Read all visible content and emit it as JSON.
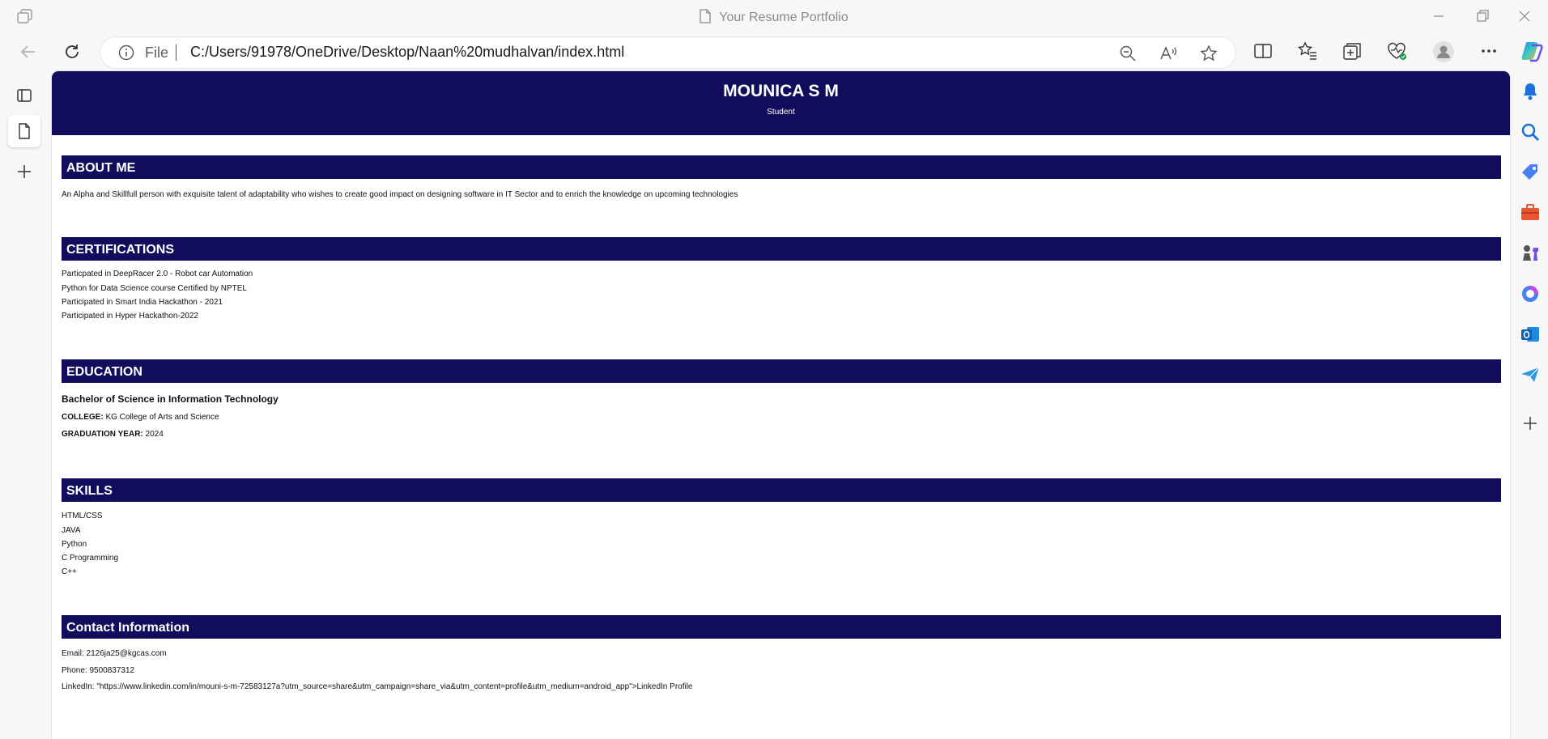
{
  "browser": {
    "tab_title": "Your Resume Portfolio",
    "address": {
      "scheme_label": "File",
      "url": "C:/Users/91978/OneDrive/Desktop/Naan%20mudhalvan/index.html"
    }
  },
  "resume": {
    "name": "MOUNICA S M",
    "role": "Student",
    "about": {
      "heading": "ABOUT ME",
      "text": "An Alpha and Skillfull person with exquisite talent of adaptability who wishes to create good impact on designing software in IT Sector and to enrich the knowledge on upcoming technologies"
    },
    "certifications": {
      "heading": "CERTIFICATIONS",
      "items": [
        "Particpated in DeepRacer 2.0 - Robot car Automation",
        "Python for Data Science course Certified by NPTEL",
        "Participated in Smart India Hackathon - 2021",
        "Participated in Hyper Hackathon-2022"
      ]
    },
    "education": {
      "heading": "EDUCATION",
      "degree": "Bachelor of Science in Information Technology",
      "college_label": "COLLEGE:",
      "college": "KG College of Arts and Science",
      "year_label": "GRADUATION YEAR:",
      "year": "2024"
    },
    "skills": {
      "heading": "SKILLS",
      "items": [
        "HTML/CSS",
        "JAVA",
        "Python",
        "C Programming",
        "C++"
      ]
    },
    "contact": {
      "heading": "Contact Information",
      "email": "Email: 2126ja25@kgcas.com",
      "phone": "Phone: 9500837312",
      "linkedin": "LinkedIn: \"https://www.linkedin.com/in/mouni-s-m-72583127a?utm_source=share&utm_campaign=share_via&utm_content=profile&utm_medium=android_app\">LinkedIn Profile"
    }
  }
}
